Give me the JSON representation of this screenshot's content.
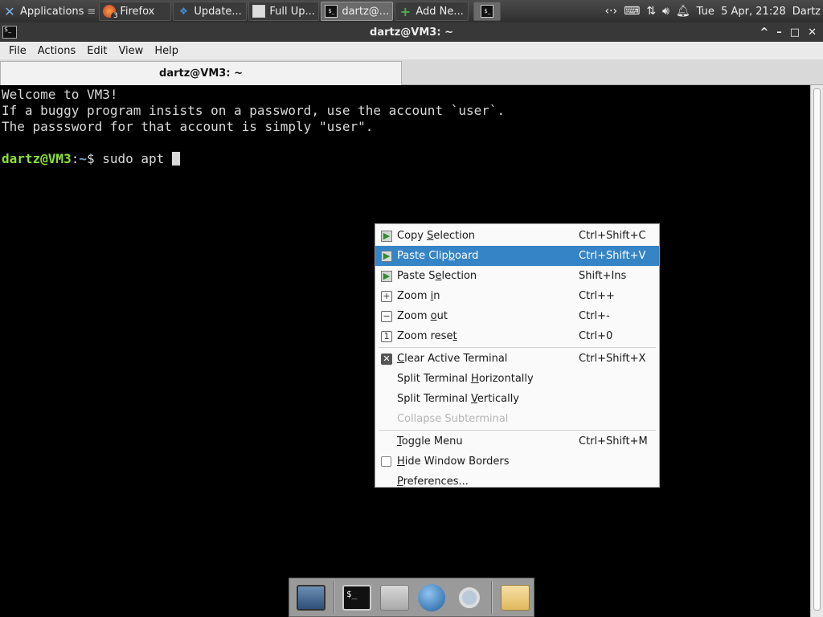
{
  "panel": {
    "applications_label": "Applications",
    "tasks": [
      {
        "label": "Firefox",
        "icon": "firefox-icon",
        "badge": "3"
      },
      {
        "label": "Update...",
        "icon": "dropbox-icon"
      },
      {
        "label": "Full Up...",
        "icon": "window-icon"
      },
      {
        "label": "dartz@...",
        "icon": "terminal-icon"
      },
      {
        "label": "Add Ne...",
        "icon": "plus-icon"
      }
    ],
    "clock": "Tue  5 Apr, 21:28",
    "user": "Dartz"
  },
  "window": {
    "title": "dartz@VM3: ~",
    "controls": {
      "maximize_up": "^",
      "minimize": "–",
      "maximize": "□",
      "close": "✕"
    }
  },
  "menubar": {
    "items": [
      "File",
      "Actions",
      "Edit",
      "View",
      "Help"
    ]
  },
  "tab": {
    "label": "dartz@VM3: ~"
  },
  "terminal": {
    "line1": "Welcome to VM3!",
    "line2": "If a buggy program insists on a password, use the account `user`.",
    "line3": "The passsword for that account is simply \"user\".",
    "prompt_user": "dartz@VM3",
    "prompt_sep": ":",
    "prompt_path": "~",
    "prompt_symbol": "$ ",
    "command": "sudo apt "
  },
  "context_menu": {
    "items": [
      {
        "pre": "Copy ",
        "u": "S",
        "post": "election",
        "accel": "Ctrl+Shift+C",
        "icon": "copy-icon"
      },
      {
        "pre": "Paste Clip",
        "u": "b",
        "post": "oard",
        "accel": "Ctrl+Shift+V",
        "icon": "paste-icon",
        "highlighted": true
      },
      {
        "pre": "Paste S",
        "u": "e",
        "post": "lection",
        "accel": "Shift+Ins",
        "icon": "paste-icon"
      },
      {
        "pre": "Zoom ",
        "u": "i",
        "post": "n",
        "accel": "Ctrl++",
        "icon": "zoom-in-icon"
      },
      {
        "pre": "Zoom ",
        "u": "o",
        "post": "ut",
        "accel": "Ctrl+-",
        "icon": "zoom-out-icon"
      },
      {
        "pre": "Zoom rese",
        "u": "t",
        "post": "",
        "accel": "Ctrl+0",
        "icon": "zoom-reset-icon"
      },
      {
        "pre": "",
        "u": "C",
        "post": "lear Active Terminal",
        "accel": "Ctrl+Shift+X",
        "icon": "clear-icon"
      },
      {
        "pre": "Split Terminal ",
        "u": "H",
        "post": "orizontally",
        "accel": ""
      },
      {
        "pre": "Split Terminal ",
        "u": "V",
        "post": "ertically",
        "accel": ""
      },
      {
        "pre": "Collapse Subterminal",
        "u": "",
        "post": "",
        "accel": "",
        "disabled": true
      },
      {
        "pre": "",
        "u": "T",
        "post": "oggle Menu",
        "accel": "Ctrl+Shift+M"
      },
      {
        "pre": "",
        "u": "H",
        "post": "ide Window Borders",
        "accel": "",
        "checkbox": true
      },
      {
        "pre": "",
        "u": "P",
        "post": "references...",
        "accel": ""
      }
    ]
  },
  "dock": {
    "items": [
      "show-desktop-icon",
      "terminal-icon",
      "home-folder-icon",
      "web-browser-icon",
      "search-icon",
      "files-icon"
    ]
  },
  "colors": {
    "panel": "#3a3a3a",
    "highlight": "#3584c6",
    "prompt_user": "#8ae234",
    "prompt_path": "#729fcf"
  }
}
